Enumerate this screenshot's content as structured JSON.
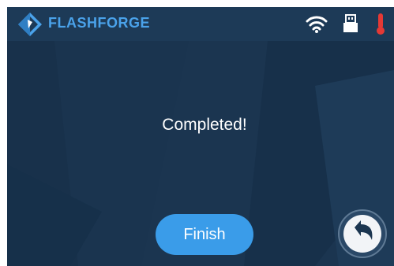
{
  "header": {
    "brand": "FLASHFORGE",
    "icons": [
      "flashforge-logo-icon",
      "wifi-icon",
      "usb-drive-icon",
      "thermometer-icon"
    ]
  },
  "main": {
    "status_text": "Completed!",
    "finish_label": "Finish",
    "back_icon": "undo-arrow-icon"
  },
  "colors": {
    "background": "#1b3550",
    "topbar": "#1d3a57",
    "accent": "#3a9ce9",
    "brand_text": "#4aa2ea",
    "thermometer": "#e53935"
  }
}
